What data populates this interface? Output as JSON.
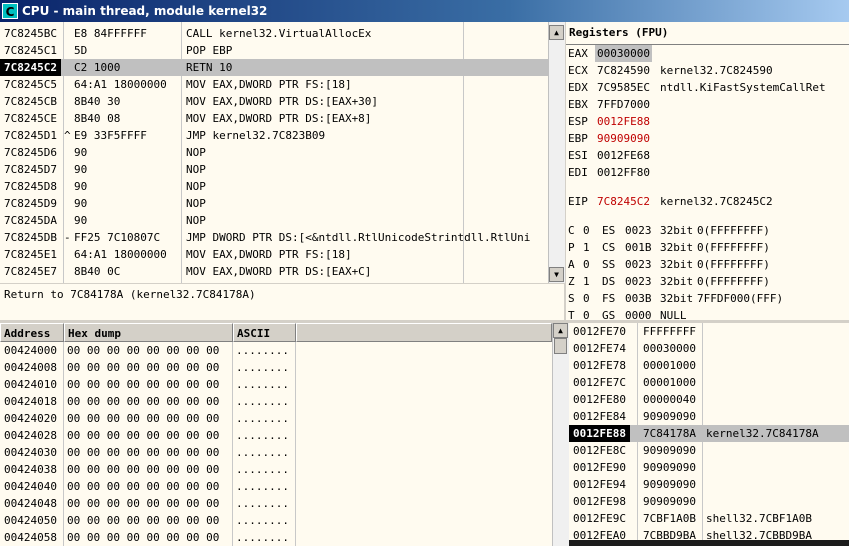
{
  "window": {
    "icon_letter": "C",
    "title": "CPU - main thread, module kernel32"
  },
  "disasm": {
    "selected_index": 2,
    "rows": [
      {
        "addr": "7C8245BC",
        "mark": "",
        "hex": "E8 84FFFFFF",
        "instr": "CALL kernel32.VirtualAllocEx"
      },
      {
        "addr": "7C8245C1",
        "mark": "",
        "hex": "5D",
        "instr": "POP EBP"
      },
      {
        "addr": "7C8245C2",
        "mark": "",
        "hex": "C2 1000",
        "instr": "RETN 10"
      },
      {
        "addr": "7C8245C5",
        "mark": "",
        "hex": "64:A1 18000000",
        "instr": "MOV EAX,DWORD PTR FS:[18]"
      },
      {
        "addr": "7C8245CB",
        "mark": "",
        "hex": "8B40 30",
        "instr": "MOV EAX,DWORD PTR DS:[EAX+30]"
      },
      {
        "addr": "7C8245CE",
        "mark": "",
        "hex": "8B40 08",
        "instr": "MOV EAX,DWORD PTR DS:[EAX+8]"
      },
      {
        "addr": "7C8245D1",
        "mark": "^",
        "hex": "E9 33F5FFFF",
        "instr": "JMP kernel32.7C823B09"
      },
      {
        "addr": "7C8245D6",
        "mark": "",
        "hex": "90",
        "instr": "NOP"
      },
      {
        "addr": "7C8245D7",
        "mark": "",
        "hex": "90",
        "instr": "NOP"
      },
      {
        "addr": "7C8245D8",
        "mark": "",
        "hex": "90",
        "instr": "NOP"
      },
      {
        "addr": "7C8245D9",
        "mark": "",
        "hex": "90",
        "instr": "NOP"
      },
      {
        "addr": "7C8245DA",
        "mark": "",
        "hex": "90",
        "instr": "NOP"
      },
      {
        "addr": "7C8245DB",
        "mark": "-",
        "hex": "FF25 7C10807C",
        "instr": "JMP DWORD PTR DS:[<&ntdll.RtlUnicodeStrintdll.RtlUni"
      },
      {
        "addr": "7C8245E1",
        "mark": "",
        "hex": "64:A1 18000000",
        "instr": "MOV EAX,DWORD PTR FS:[18]"
      },
      {
        "addr": "7C8245E7",
        "mark": "",
        "hex": "8B40 0C",
        "instr": "MOV EAX,DWORD PTR DS:[EAX+C]"
      }
    ]
  },
  "info": {
    "text": "Return to 7C84178A (kernel32.7C84178A)"
  },
  "registers": {
    "header": "Registers (FPU)",
    "gp": [
      {
        "name": "EAX",
        "value": "00030000",
        "comment": "",
        "changed": false,
        "highlight": true
      },
      {
        "name": "ECX",
        "value": "7C824590",
        "comment": "kernel32.7C824590",
        "changed": false
      },
      {
        "name": "EDX",
        "value": "7C9585EC",
        "comment": "ntdll.KiFastSystemCallRet",
        "changed": false
      },
      {
        "name": "EBX",
        "value": "7FFD7000",
        "comment": "",
        "changed": false
      },
      {
        "name": "ESP",
        "value": "0012FE88",
        "comment": "",
        "changed": true
      },
      {
        "name": "EBP",
        "value": "90909090",
        "comment": "",
        "changed": true
      },
      {
        "name": "ESI",
        "value": "0012FE68",
        "comment": "",
        "changed": false
      },
      {
        "name": "EDI",
        "value": "0012FF80",
        "comment": "",
        "changed": false
      }
    ],
    "eip": {
      "name": "EIP",
      "value": "7C8245C2",
      "comment": "kernel32.7C8245C2"
    },
    "flags": [
      {
        "flag": "C",
        "bit": "0",
        "seg": "ES",
        "sel": "0023",
        "width": "32bit",
        "range": "0(FFFFFFFF)"
      },
      {
        "flag": "P",
        "bit": "1",
        "seg": "CS",
        "sel": "001B",
        "width": "32bit",
        "range": "0(FFFFFFFF)"
      },
      {
        "flag": "A",
        "bit": "0",
        "seg": "SS",
        "sel": "0023",
        "width": "32bit",
        "range": "0(FFFFFFFF)"
      },
      {
        "flag": "Z",
        "bit": "1",
        "seg": "DS",
        "sel": "0023",
        "width": "32bit",
        "range": "0(FFFFFFFF)"
      },
      {
        "flag": "S",
        "bit": "0",
        "seg": "FS",
        "sel": "003B",
        "width": "32bit",
        "range": "7FFDF000(FFF)"
      },
      {
        "flag": "T",
        "bit": "0",
        "seg": "GS",
        "sel": "0000",
        "width": "NULL",
        "range": ""
      }
    ]
  },
  "dump": {
    "headers": {
      "address": "Address",
      "hex": "Hex dump",
      "ascii": "ASCII"
    },
    "rows": [
      {
        "addr": "00424000",
        "hex": "00 00 00 00 00 00 00 00",
        "ascii": "........"
      },
      {
        "addr": "00424008",
        "hex": "00 00 00 00 00 00 00 00",
        "ascii": "........"
      },
      {
        "addr": "00424010",
        "hex": "00 00 00 00 00 00 00 00",
        "ascii": "........"
      },
      {
        "addr": "00424018",
        "hex": "00 00 00 00 00 00 00 00",
        "ascii": "........"
      },
      {
        "addr": "00424020",
        "hex": "00 00 00 00 00 00 00 00",
        "ascii": "........"
      },
      {
        "addr": "00424028",
        "hex": "00 00 00 00 00 00 00 00",
        "ascii": "........"
      },
      {
        "addr": "00424030",
        "hex": "00 00 00 00 00 00 00 00",
        "ascii": "........"
      },
      {
        "addr": "00424038",
        "hex": "00 00 00 00 00 00 00 00",
        "ascii": "........"
      },
      {
        "addr": "00424040",
        "hex": "00 00 00 00 00 00 00 00",
        "ascii": "........"
      },
      {
        "addr": "00424048",
        "hex": "00 00 00 00 00 00 00 00",
        "ascii": "........"
      },
      {
        "addr": "00424050",
        "hex": "00 00 00 00 00 00 00 00",
        "ascii": "........"
      },
      {
        "addr": "00424058",
        "hex": "00 00 00 00 00 00 00 00",
        "ascii": "........"
      }
    ]
  },
  "stack": {
    "selected_index": 6,
    "rows": [
      {
        "addr": "0012FE70",
        "value": "FFFFFFFF",
        "comment": ""
      },
      {
        "addr": "0012FE74",
        "value": "00030000",
        "comment": ""
      },
      {
        "addr": "0012FE78",
        "value": "00001000",
        "comment": ""
      },
      {
        "addr": "0012FE7C",
        "value": "00001000",
        "comment": ""
      },
      {
        "addr": "0012FE80",
        "value": "00000040",
        "comment": ""
      },
      {
        "addr": "0012FE84",
        "value": "90909090",
        "comment": ""
      },
      {
        "addr": "0012FE88",
        "value": "7C84178A",
        "comment": "kernel32.7C84178A"
      },
      {
        "addr": "0012FE8C",
        "value": "90909090",
        "comment": ""
      },
      {
        "addr": "0012FE90",
        "value": "90909090",
        "comment": ""
      },
      {
        "addr": "0012FE94",
        "value": "90909090",
        "comment": ""
      },
      {
        "addr": "0012FE98",
        "value": "90909090",
        "comment": ""
      },
      {
        "addr": "0012FE9C",
        "value": "7CBF1A0B",
        "comment": "shell32.7CBF1A0B"
      },
      {
        "addr": "0012FEA0",
        "value": "7CBBD9BA",
        "comment": "shell32.7CBBD9BA"
      }
    ]
  },
  "colors": {
    "pane_bg": "#fffbf0",
    "changed_red": "#c00000",
    "select_gray": "#c0c0c0"
  }
}
